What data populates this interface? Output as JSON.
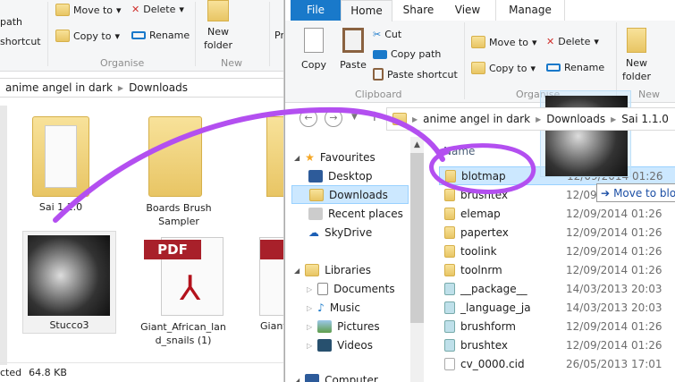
{
  "left_window": {
    "ribbon": {
      "path_label": "path",
      "shortcut_label": "shortcut",
      "move_to": "Move to",
      "copy_to": "Copy to",
      "delete": "Delete",
      "rename": "Rename",
      "new_folder": "New folder",
      "organise_group": "Organise",
      "new_group": "New",
      "properties_partial": "Pr"
    },
    "breadcrumb": [
      "anime angel in dark",
      "Downloads"
    ],
    "items": [
      {
        "name": "Sai 1.1.0",
        "type": "folder"
      },
      {
        "name": "Boards Brush Sampler",
        "type": "folder"
      },
      {
        "name": "Stucco3",
        "type": "image",
        "selected": true
      },
      {
        "name": "Giant_African_land_snails (1)",
        "type": "pdf"
      },
      {
        "name": "Giant",
        "type": "pdf"
      }
    ],
    "pdf_badge": "PDF",
    "status": {
      "selected_partial": "cted",
      "size": "64.8 KB"
    }
  },
  "right_window": {
    "tabs": [
      {
        "label": "File",
        "active": false
      },
      {
        "label": "Home",
        "active": true
      },
      {
        "label": "Share"
      },
      {
        "label": "View"
      },
      {
        "label": "Manage"
      }
    ],
    "ribbon": {
      "copy": "Copy",
      "paste": "Paste",
      "cut": "Cut",
      "copy_path": "Copy path",
      "paste_shortcut": "Paste shortcut",
      "clipboard_group": "Clipboard",
      "move_to": "Move to",
      "copy_to": "Copy to",
      "delete": "Delete",
      "rename": "Rename",
      "organise_group": "Organise",
      "new_folder": "New folder",
      "new_group": "New"
    },
    "breadcrumb": [
      "anime angel in dark",
      "Downloads",
      "Sai 1.1.0"
    ],
    "nav": {
      "favourites": "Favourites",
      "items_fav": [
        "Desktop",
        "Downloads",
        "Recent places",
        "SkyDrive"
      ],
      "libraries": "Libraries",
      "items_lib": [
        "Documents",
        "Music",
        "Pictures",
        "Videos"
      ],
      "computer": "Computer"
    },
    "column_name": "Name",
    "files": [
      {
        "name": "blotmap",
        "date": "12/09/2014 01:26",
        "type": "folder"
      },
      {
        "name": "brushtex",
        "date": "12/09/2014 01:26",
        "type": "folder"
      },
      {
        "name": "elemap",
        "date": "12/09/2014 01:26",
        "type": "folder"
      },
      {
        "name": "papertex",
        "date": "12/09/2014 01:26",
        "type": "folder"
      },
      {
        "name": "toolink",
        "date": "12/09/2014 01:26",
        "type": "folder"
      },
      {
        "name": "toolnrm",
        "date": "12/09/2014 01:26",
        "type": "folder"
      },
      {
        "name": "__package__",
        "date": "14/03/2013 20:03",
        "type": "text"
      },
      {
        "name": "_language_ja",
        "date": "14/03/2013 20:03",
        "type": "text"
      },
      {
        "name": "brushform",
        "date": "12/09/2014 01:26",
        "type": "text"
      },
      {
        "name": "brushtex",
        "date": "12/09/2014 01:26",
        "type": "text"
      },
      {
        "name": "cv_0000.cid",
        "date": "26/05/2013 17:01",
        "type": "file"
      }
    ],
    "drag_tooltip": "Move to blot"
  },
  "colors": {
    "accent": "#1979ca",
    "selection": "#cce8ff",
    "annotation": "#b34ff0"
  }
}
